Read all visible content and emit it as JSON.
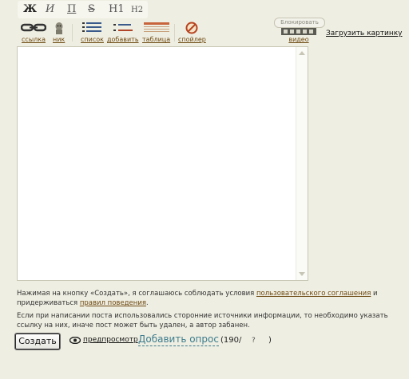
{
  "format_toolbar": {
    "bold": "Ж",
    "italic": "И",
    "underline": "П",
    "strike": "S",
    "h1": "H1",
    "h2": "H2"
  },
  "tools": {
    "link": "ссылка",
    "nick": "ник",
    "list": "список",
    "add": "добавить",
    "table": "таблица",
    "spoiler": "спойлер",
    "video_block": "Блокировать",
    "video": "видео"
  },
  "upload_label": "Загрузить картинку",
  "editor": {
    "value": ""
  },
  "notes": {
    "agreement_pre": "Нажимая на кнопку «Создать», я соглашаюсь соблюдать условия ",
    "agreement_link": "пользовательского соглашения",
    "agreement_mid": " и придерживаться ",
    "rules_link": "правил поведения",
    "agreement_end": ".",
    "sources": "Если при написании поста использовались сторонние источники информации, то необходимо указать ссылку на них, иначе пост может быть удален, а автор забанен."
  },
  "actions": {
    "create": "Создать",
    "preview": "предпросмотр",
    "add_poll": "Добавить опрос",
    "counter": "(190/",
    "help": "?",
    "close_paren": ")"
  },
  "colors": {
    "background": "#efeee2",
    "link_brown": "#6e4a12",
    "poll_teal": "#3c7c8c"
  }
}
